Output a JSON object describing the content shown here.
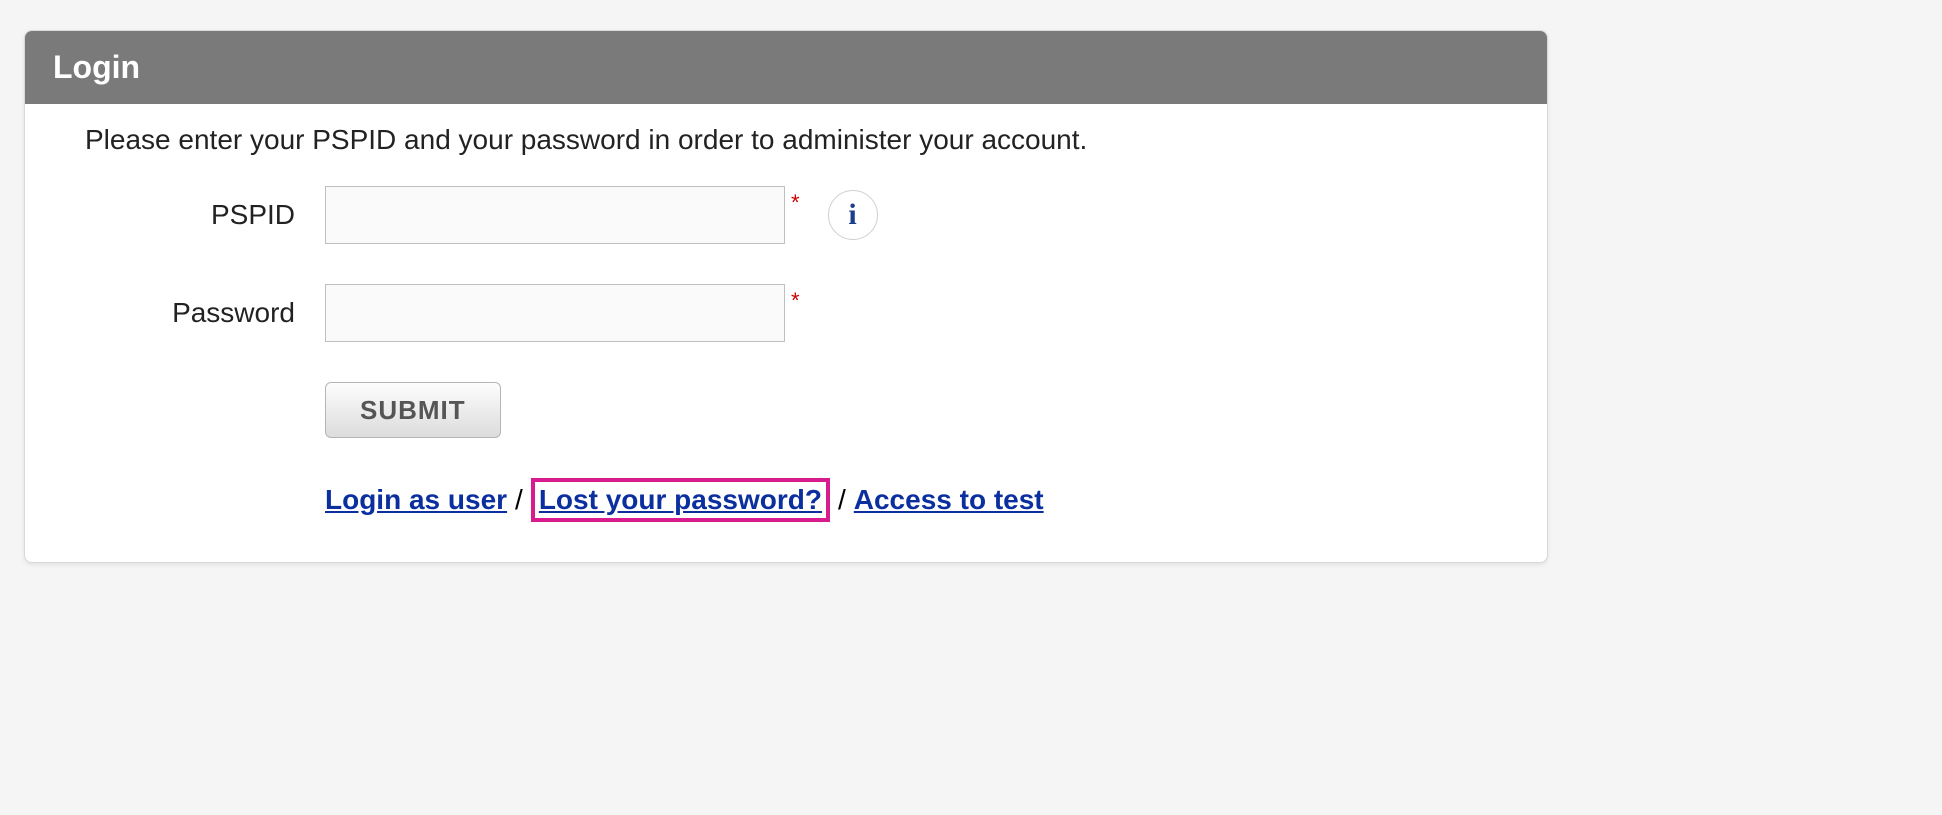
{
  "panel": {
    "title": "Login",
    "instructions": "Please enter your PSPID and your password in order to administer your account."
  },
  "form": {
    "pspid": {
      "label": "PSPID",
      "value": "",
      "required_marker": "*",
      "info_glyph": "i"
    },
    "password": {
      "label": "Password",
      "value": "",
      "required_marker": "*"
    },
    "submit_label": "SUBMIT"
  },
  "links": {
    "login_as_user": "Login as user",
    "lost_password": "Lost your password?",
    "access_to_test": "Access to test",
    "separator": "/"
  }
}
